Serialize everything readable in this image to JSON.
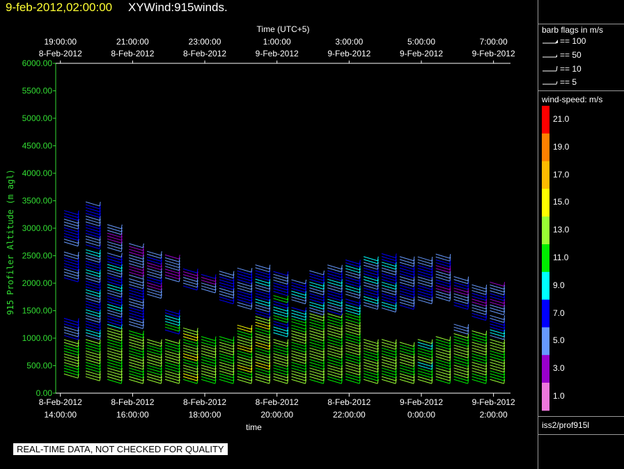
{
  "header": {
    "date_title": "9-feb-2012,02:00:00",
    "product_title": "XYWind:915winds."
  },
  "quality_note": "REAL-TIME DATA, NOT CHECKED FOR QUALITY",
  "barb_legend": {
    "title": "barb flags in m/s",
    "items": [
      "== 100",
      "== 50",
      "== 10",
      "== 5"
    ]
  },
  "speed_legend": {
    "title": "wind-speed: m/s",
    "bins": [
      {
        "label": "21.0",
        "color": "#ff0000"
      },
      {
        "label": "19.0",
        "color": "#ff8000"
      },
      {
        "label": "17.0",
        "color": "#ffbb00"
      },
      {
        "label": "15.0",
        "color": "#ffff00"
      },
      {
        "label": "13.0",
        "color": "#99ff33"
      },
      {
        "label": "11.0",
        "color": "#00ee00"
      },
      {
        "label": "9.0",
        "color": "#00ffff"
      },
      {
        "label": "7.0",
        "color": "#0000ff"
      },
      {
        "label": "5.0",
        "color": "#6699ff"
      },
      {
        "label": "3.0",
        "color": "#9900cc"
      },
      {
        "label": "1.0",
        "color": "#ee77dd"
      }
    ]
  },
  "source": "iss2/prof915l",
  "chart_data": {
    "type": "scatter",
    "ylabel": "915 Profiler Altitude (m agl)",
    "xlabel": "time",
    "top_axis_label": "Time (UTC+5)",
    "ylim": [
      0,
      6000
    ],
    "yticks": [
      "0.00",
      "500.00",
      "1000.00",
      "1500.00",
      "2000.00",
      "2500.00",
      "3000.00",
      "3500.00",
      "4000.00",
      "4500.00",
      "5000.00",
      "5500.00",
      "6000.00"
    ],
    "bottom_ticks": [
      {
        "date": "8-Feb-2012",
        "time": "14:00:00",
        "h": 0
      },
      {
        "date": "8-Feb-2012",
        "time": "16:00:00",
        "h": 2
      },
      {
        "date": "8-Feb-2012",
        "time": "18:00:00",
        "h": 4
      },
      {
        "date": "8-Feb-2012",
        "time": "20:00:00",
        "h": 6
      },
      {
        "date": "8-Feb-2012",
        "time": "22:00:00",
        "h": 8
      },
      {
        "date": "9-Feb-2012",
        "time": "0:00:00",
        "h": 10
      },
      {
        "date": "9-Feb-2012",
        "time": "2:00:00",
        "h": 12
      }
    ],
    "top_ticks": [
      {
        "time": "19:00:00",
        "date": "8-Feb-2012",
        "h": 0
      },
      {
        "time": "21:00:00",
        "date": "8-Feb-2012",
        "h": 2
      },
      {
        "time": "23:00:00",
        "date": "8-Feb-2012",
        "h": 4
      },
      {
        "time": "1:00:00",
        "date": "9-Feb-2012",
        "h": 6
      },
      {
        "time": "3:00:00",
        "date": "9-Feb-2012",
        "h": 8
      },
      {
        "time": "5:00:00",
        "date": "9-Feb-2012",
        "h": 10
      },
      {
        "time": "7:00:00",
        "date": "9-Feb-2012",
        "h": 12
      }
    ],
    "xlim_hours": [
      -0.13,
      12.47
    ],
    "profiles": [
      {
        "t": 0.1,
        "columns": [
          {
            "from": 350,
            "to": 1000,
            "speed": 12,
            "dir": 30
          },
          {
            "from": 1050,
            "to": 1400,
            "speed": 6,
            "dir": 30
          },
          {
            "from": 2100,
            "to": 2600,
            "speed": 6,
            "dir": 30
          },
          {
            "from": 2750,
            "to": 3350,
            "speed": 6,
            "dir": 30
          }
        ]
      },
      {
        "t": 0.7,
        "columns": [
          {
            "from": 300,
            "to": 1000,
            "speed": 12,
            "dir": 30
          },
          {
            "from": 1050,
            "to": 2650,
            "speed": 7,
            "dir": 30
          },
          {
            "from": 2700,
            "to": 3500,
            "speed": 6,
            "dir": 30
          }
        ]
      },
      {
        "t": 1.3,
        "columns": [
          {
            "from": 250,
            "to": 1200,
            "speed": 12,
            "dir": 30
          },
          {
            "from": 1250,
            "to": 2600,
            "speed": 7,
            "dir": 30
          },
          {
            "from": 2650,
            "to": 3100,
            "speed": 4,
            "dir": 30
          }
        ]
      },
      {
        "t": 1.9,
        "columns": [
          {
            "from": 250,
            "to": 1150,
            "speed": 12,
            "dir": 30
          },
          {
            "from": 1250,
            "to": 2100,
            "speed": 6,
            "dir": 30
          },
          {
            "from": 2150,
            "to": 2750,
            "speed": 4,
            "dir": 30
          }
        ]
      },
      {
        "t": 2.4,
        "columns": [
          {
            "from": 250,
            "to": 1000,
            "speed": 12,
            "dir": 30
          },
          {
            "from": 1800,
            "to": 2600,
            "speed": 5,
            "dir": 30
          }
        ]
      },
      {
        "t": 2.9,
        "columns": [
          {
            "from": 250,
            "to": 1000,
            "speed": 12,
            "dir": 30
          },
          {
            "from": 1150,
            "to": 1550,
            "speed": 9,
            "dir": 30
          },
          {
            "from": 2100,
            "to": 2550,
            "speed": 4,
            "dir": 30
          }
        ]
      },
      {
        "t": 3.4,
        "columns": [
          {
            "from": 250,
            "to": 1200,
            "speed": 13,
            "dir": 30
          },
          {
            "from": 1950,
            "to": 2300,
            "speed": 5,
            "dir": 30
          }
        ]
      },
      {
        "t": 3.9,
        "columns": [
          {
            "from": 250,
            "to": 1050,
            "speed": 12,
            "dir": 30
          },
          {
            "from": 1900,
            "to": 2200,
            "speed": 5,
            "dir": 30
          }
        ]
      },
      {
        "t": 4.4,
        "columns": [
          {
            "from": 250,
            "to": 1050,
            "speed": 12,
            "dir": 30
          },
          {
            "from": 1700,
            "to": 2250,
            "speed": 6,
            "dir": 30
          }
        ]
      },
      {
        "t": 4.9,
        "columns": [
          {
            "from": 250,
            "to": 1250,
            "speed": 13,
            "dir": 30
          },
          {
            "from": 1600,
            "to": 2300,
            "speed": 6,
            "dir": 30
          }
        ]
      },
      {
        "t": 5.4,
        "columns": [
          {
            "from": 250,
            "to": 1400,
            "speed": 13,
            "dir": 30
          },
          {
            "from": 1450,
            "to": 2350,
            "speed": 7,
            "dir": 30
          }
        ]
      },
      {
        "t": 5.9,
        "columns": [
          {
            "from": 250,
            "to": 1000,
            "speed": 12,
            "dir": 30
          },
          {
            "from": 1100,
            "to": 1800,
            "speed": 9,
            "dir": 30
          },
          {
            "from": 1850,
            "to": 2250,
            "speed": 6,
            "dir": 30
          }
        ]
      },
      {
        "t": 6.4,
        "columns": [
          {
            "from": 250,
            "to": 1250,
            "speed": 12,
            "dir": 30
          },
          {
            "from": 1300,
            "to": 1600,
            "speed": 9,
            "dir": 30
          },
          {
            "from": 1700,
            "to": 2100,
            "speed": 7,
            "dir": 30
          }
        ]
      },
      {
        "t": 6.9,
        "columns": [
          {
            "from": 250,
            "to": 1450,
            "speed": 12,
            "dir": 30
          },
          {
            "from": 1500,
            "to": 2250,
            "speed": 7,
            "dir": 30
          }
        ]
      },
      {
        "t": 7.4,
        "columns": [
          {
            "from": 250,
            "to": 1450,
            "speed": 12,
            "dir": 30
          },
          {
            "from": 1500,
            "to": 2350,
            "speed": 7,
            "dir": 30
          }
        ]
      },
      {
        "t": 7.9,
        "columns": [
          {
            "from": 250,
            "to": 1350,
            "speed": 12,
            "dir": 30
          },
          {
            "from": 1400,
            "to": 1750,
            "speed": 9,
            "dir": 30
          },
          {
            "from": 1800,
            "to": 2450,
            "speed": 7,
            "dir": 30
          }
        ]
      },
      {
        "t": 8.4,
        "columns": [
          {
            "from": 250,
            "to": 1000,
            "speed": 12,
            "dir": 30
          },
          {
            "from": 1600,
            "to": 2500,
            "speed": 7,
            "dir": 30
          }
        ]
      },
      {
        "t": 8.9,
        "columns": [
          {
            "from": 250,
            "to": 1000,
            "speed": 12,
            "dir": 30
          },
          {
            "from": 1550,
            "to": 2550,
            "speed": 7,
            "dir": 30
          }
        ]
      },
      {
        "t": 9.4,
        "columns": [
          {
            "from": 250,
            "to": 950,
            "speed": 12,
            "dir": 30
          },
          {
            "from": 1600,
            "to": 2500,
            "speed": 6,
            "dir": 30
          }
        ]
      },
      {
        "t": 9.9,
        "columns": [
          {
            "from": 250,
            "to": 1000,
            "speed": 11,
            "dir": 30
          },
          {
            "from": 1700,
            "to": 2500,
            "speed": 6,
            "dir": 30
          }
        ]
      },
      {
        "t": 10.4,
        "columns": [
          {
            "from": 250,
            "to": 1050,
            "speed": 12,
            "dir": 30
          },
          {
            "from": 1750,
            "to": 2550,
            "speed": 5,
            "dir": 30
          }
        ]
      },
      {
        "t": 10.9,
        "columns": [
          {
            "from": 250,
            "to": 1100,
            "speed": 12,
            "dir": 30
          },
          {
            "from": 1150,
            "to": 1300,
            "speed": 6,
            "dir": 30
          },
          {
            "from": 1600,
            "to": 2150,
            "speed": 5,
            "dir": 30
          }
        ]
      },
      {
        "t": 11.4,
        "columns": [
          {
            "from": 250,
            "to": 1150,
            "speed": 12,
            "dir": 30
          },
          {
            "from": 1400,
            "to": 2000,
            "speed": 5,
            "dir": 30
          }
        ]
      },
      {
        "t": 11.9,
        "columns": [
          {
            "from": 250,
            "to": 1000,
            "speed": 12,
            "dir": 30
          },
          {
            "from": 1050,
            "to": 1450,
            "speed": 7,
            "dir": 30
          },
          {
            "from": 1500,
            "to": 2050,
            "speed": 5,
            "dir": 30
          }
        ]
      }
    ]
  }
}
